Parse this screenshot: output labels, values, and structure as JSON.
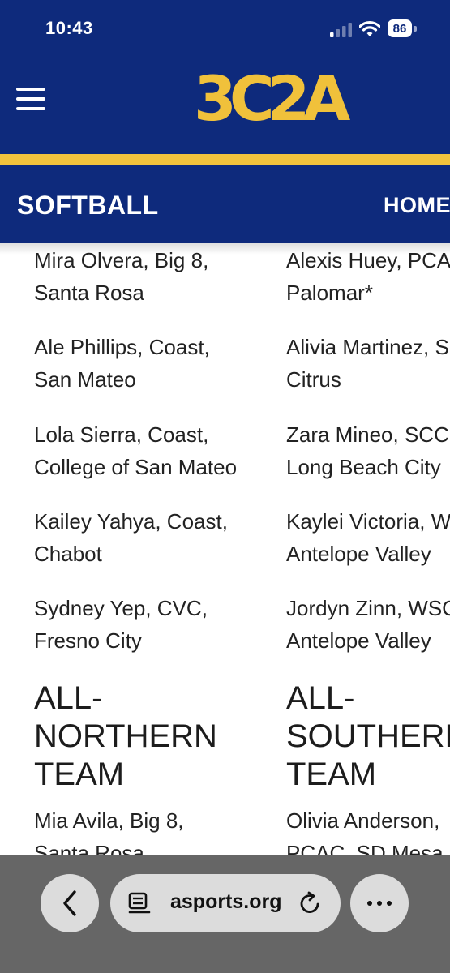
{
  "status_bar": {
    "time": "10:43",
    "battery": "86"
  },
  "header": {
    "logo_text": "3C2A",
    "brand_colors": {
      "navy": "#0e2a7c",
      "gold": "#f2c33d"
    }
  },
  "nav": {
    "section_title": "SOFTBALL",
    "home_label": "HOME"
  },
  "content": {
    "left_column": {
      "entries": [
        [
          "Mira Olvera, Big 8,",
          "Santa Rosa"
        ],
        [
          "Ale Phillips, Coast,",
          "San Mateo"
        ],
        [
          "Lola Sierra, Coast,",
          "College of San Mateo"
        ],
        [
          "Kailey Yahya, Coast,",
          "Chabot"
        ],
        [
          "Sydney Yep, CVC,",
          "Fresno City"
        ]
      ],
      "heading": [
        "ALL-",
        "NORTHERN",
        "TEAM"
      ],
      "next_entry": [
        "Mia Avila, Big 8,",
        "Santa Rosa"
      ]
    },
    "right_column": {
      "entries": [
        [
          "Alexis Huey, PCAC,",
          "Palomar*"
        ],
        [
          "Alivia Martinez, SCC,",
          "Citrus"
        ],
        [
          "Zara Mineo, SCC,",
          "Long Beach City"
        ],
        [
          "Kaylei Victoria, WSC,",
          "Antelope Valley"
        ],
        [
          "Jordyn Zinn, WSC,",
          "Antelope Valley"
        ]
      ],
      "heading": [
        "ALL-",
        "SOUTHERN",
        "TEAM"
      ],
      "next_entry": [
        "Olivia Anderson,",
        "PCAC, SD Mesa"
      ]
    }
  },
  "browser": {
    "url": "asports.org",
    "back_icon": "chevron-left-icon",
    "reader_icon": "reader-mode-icon",
    "reload_icon": "reload-icon",
    "more_icon": "more-horizontal-icon"
  }
}
